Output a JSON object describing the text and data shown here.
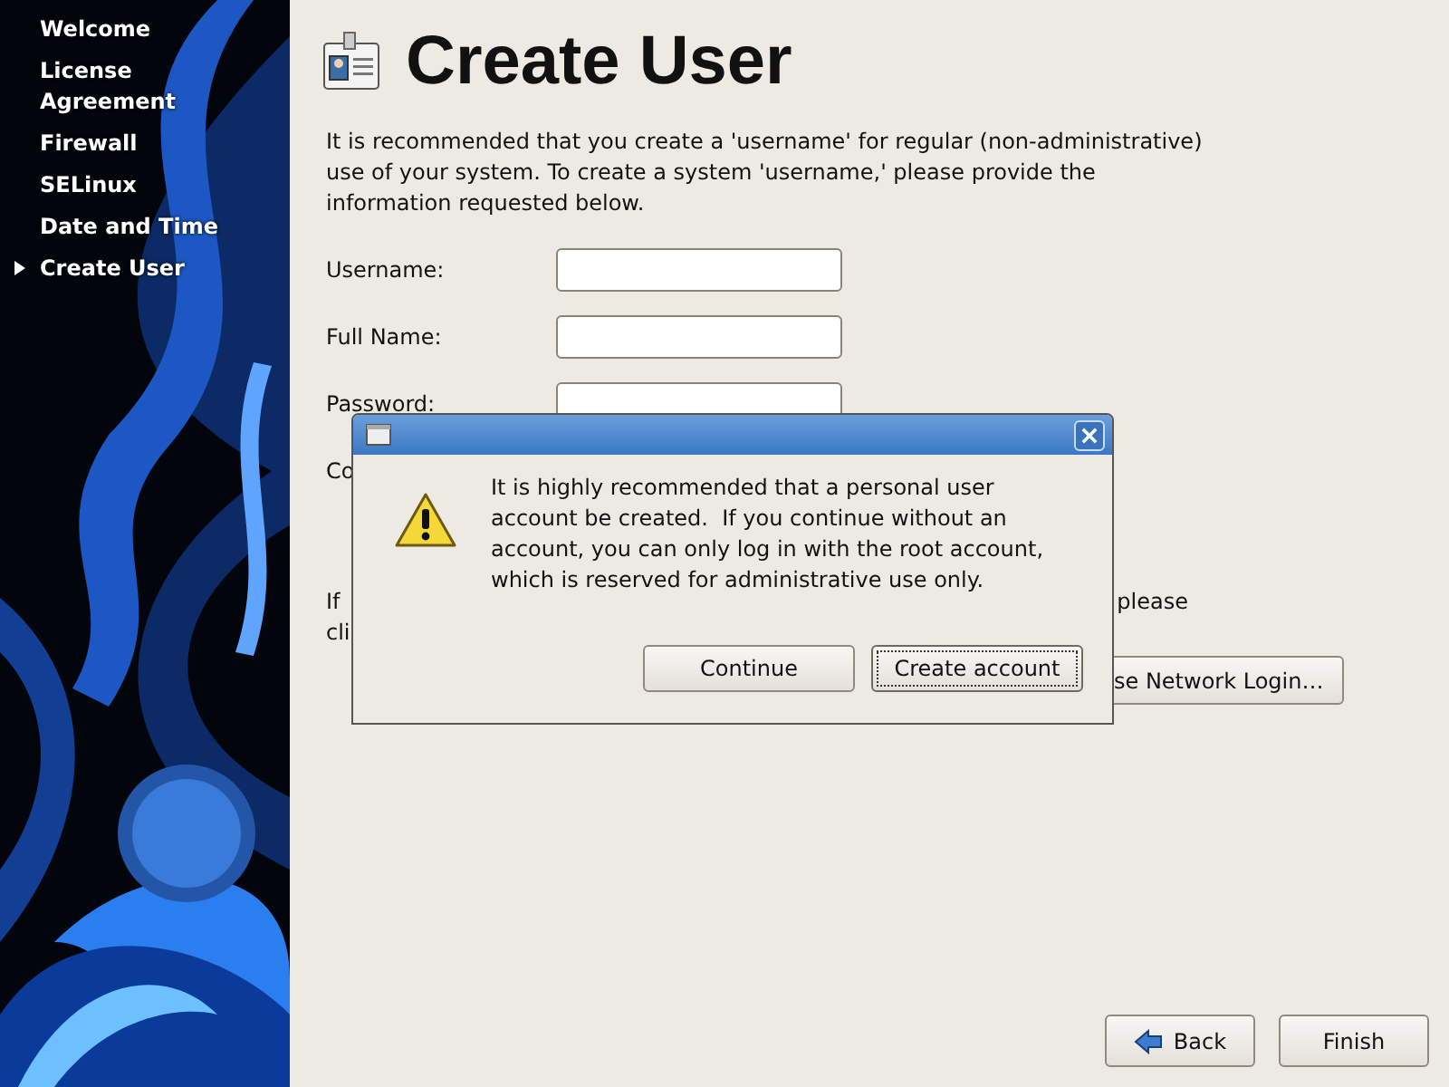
{
  "sidebar": {
    "items": [
      {
        "label": "Welcome",
        "selected": false
      },
      {
        "label": "License Agreement",
        "selected": false
      },
      {
        "label": "Firewall",
        "selected": false
      },
      {
        "label": "SELinux",
        "selected": false
      },
      {
        "label": "Date and Time",
        "selected": false
      },
      {
        "label": "Create User",
        "selected": true
      }
    ]
  },
  "page": {
    "title": "Create User",
    "intro": "It is recommended that you create a 'username' for regular (non-administrative) use of your system. To create a system 'username,' please provide the information requested below.",
    "fields": [
      {
        "label": "Username:"
      },
      {
        "label": "Full Name:"
      },
      {
        "label": "Password:"
      }
    ],
    "covered_label": "Co",
    "covered_paragraph": {
      "line_1_start": "If",
      "line_1_end": "please",
      "line_2_start": "cli"
    },
    "network_login_button": "se Network Login…"
  },
  "dialog": {
    "message": "It is highly recommended that a personal user account be created.  If you continue without an account, you can only log in with the root account, which is reserved for administrative use only.",
    "buttons": [
      {
        "label": "Continue",
        "focused": false
      },
      {
        "label": "Create account",
        "focused": true
      }
    ]
  },
  "nav_buttons": [
    {
      "label": "Back",
      "kind": "back"
    },
    {
      "label": "Finish",
      "kind": "plain"
    }
  ]
}
